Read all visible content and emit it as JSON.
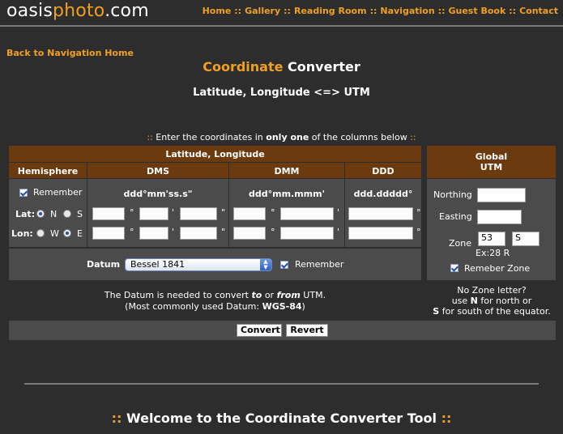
{
  "header": {
    "logo_a": "oasis",
    "logo_b": "photo",
    "logo_c": ".com",
    "nav": [
      "Home",
      "Gallery",
      "Reading Room",
      "Navigation",
      "Guest Book",
      "Contact"
    ],
    "nav_sep": "::"
  },
  "back_link": "Back to Navigation Home",
  "title": {
    "highlight": "Coordinate",
    "rest": " Converter"
  },
  "subtitle": "Latitude, Longitude <=> UTM",
  "instructions": {
    "prefix": "::",
    "a": " Enter the coordinates in ",
    "b": "only one",
    "c": " of the columns below ",
    "suffix": "::"
  },
  "latlon_panel": {
    "title": "Latitude, Longitude",
    "col_hemisphere": "Hemisphere",
    "col_dms": "DMS",
    "col_dmm": "DMM",
    "col_ddd": "DDD",
    "remember_label": "Remember",
    "fmt_dms": "ddd°mm'ss.s\"",
    "fmt_dmm": "ddd°mm.mmm'",
    "fmt_ddd": "ddd.ddddd°",
    "lat_label": "Lat:",
    "lon_label": "Lon:",
    "n_label": "N",
    "s_label": "S",
    "w_label": "W",
    "e_label": "E",
    "sym_deg": "°",
    "sym_min": "'",
    "sym_sec": "\""
  },
  "datum": {
    "label": "Datum",
    "selected": "Bessel 1841",
    "remember_label": "Remember",
    "note_a": "The Datum is needed to convert ",
    "note_to": "to",
    "note_or": " or ",
    "note_from": "from",
    "note_b": " UTM.",
    "note2_a": "(Most commonly used Datum: ",
    "note2_b": "WGS-84",
    "note2_c": ")"
  },
  "utm_panel": {
    "title_1": "Global",
    "title_2": "UTM",
    "northing_label": "Northing",
    "easting_label": "Easting",
    "zone_label": "Zone",
    "zone_number": "53",
    "zone_letter": "S",
    "zone_example": "Ex:28 R",
    "remember_label": "Remeber Zone",
    "note1": "No Zone letter?",
    "note2_a": "use ",
    "note2_n": "N",
    "note2_b": " for north or",
    "note3_s": "S",
    "note3_b": " for south of the equator."
  },
  "buttons": {
    "convert": "Convert",
    "revert": "Revert"
  },
  "welcome": {
    "prefix": "::",
    "text": " Welcome to the Coordinate Converter Tool ",
    "suffix": "::"
  }
}
